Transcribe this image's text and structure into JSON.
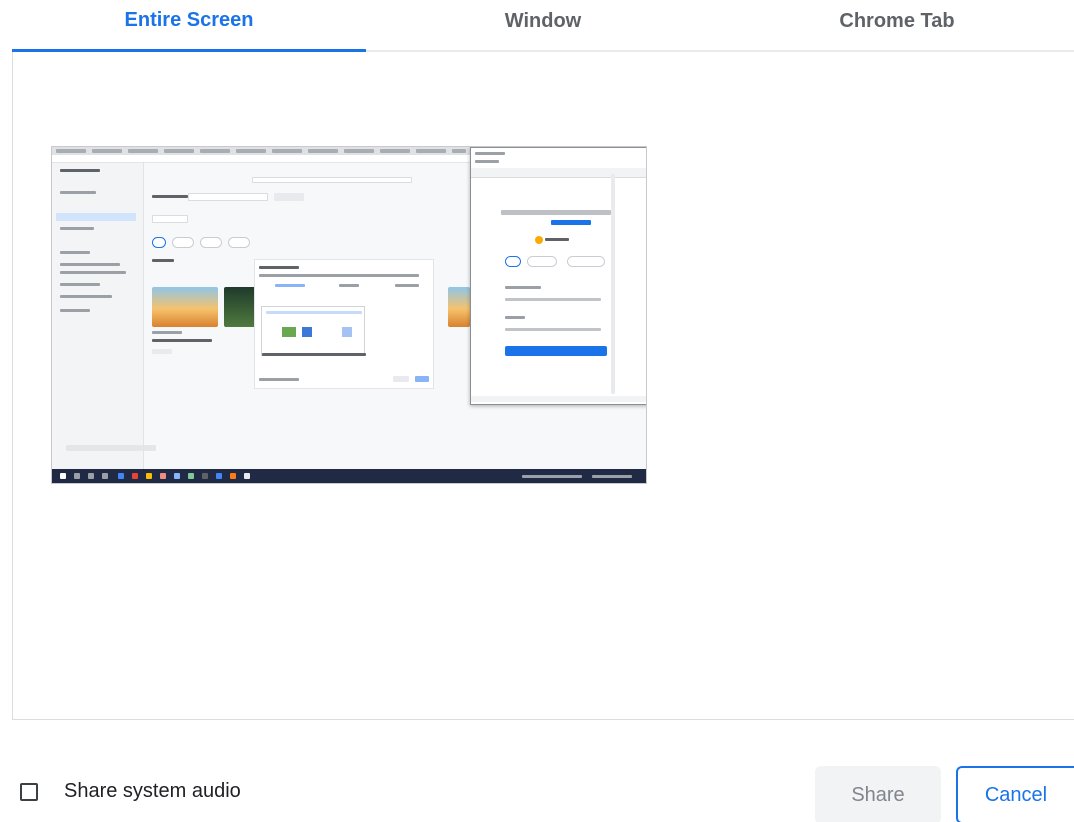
{
  "tabs": [
    {
      "label": "Entire Screen",
      "active": true
    },
    {
      "label": "Window",
      "active": false
    },
    {
      "label": "Chrome Tab",
      "active": false
    }
  ],
  "preview": {
    "icon": "screen-thumbnail-icon"
  },
  "footer": {
    "audio_label": "Share system audio",
    "audio_checked": false,
    "share_label": "Share",
    "cancel_label": "Cancel"
  },
  "colors": {
    "accent": "#1a73e8",
    "muted_button": "#f1f3f4",
    "divider": "#dadce0"
  }
}
